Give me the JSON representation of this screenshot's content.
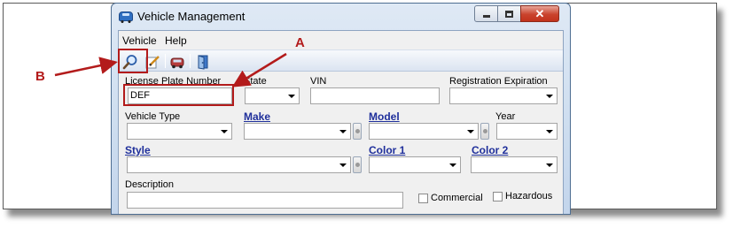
{
  "window": {
    "title": "Vehicle Management",
    "close_glyph": "✕"
  },
  "menu": {
    "vehicle": "Vehicle",
    "help": "Help"
  },
  "toolbar": {
    "icons": [
      "search-icon",
      "edit-icon",
      "vehicle-icon",
      "exit-icon"
    ]
  },
  "form": {
    "license_plate": {
      "label": "License Plate Number",
      "value": "DEF"
    },
    "state": {
      "label": "State",
      "value": ""
    },
    "vin": {
      "label": "VIN",
      "value": ""
    },
    "registration_expiration": {
      "label": "Registration Expiration",
      "value": ""
    },
    "vehicle_type": {
      "label": "Vehicle Type",
      "value": ""
    },
    "make": {
      "label": "Make",
      "value": ""
    },
    "model": {
      "label": "Model",
      "value": ""
    },
    "year": {
      "label": "Year",
      "value": ""
    },
    "style": {
      "label": "Style",
      "value": ""
    },
    "color1": {
      "label": "Color 1",
      "value": ""
    },
    "color2": {
      "label": "Color 2",
      "value": ""
    },
    "description": {
      "label": "Description",
      "value": ""
    },
    "commercial": {
      "label": "Commercial",
      "checked": false
    },
    "hazardous": {
      "label": "Hazardous",
      "checked": false
    }
  },
  "annotations": {
    "a": "A",
    "b": "B",
    "color": "#b31b1b"
  }
}
